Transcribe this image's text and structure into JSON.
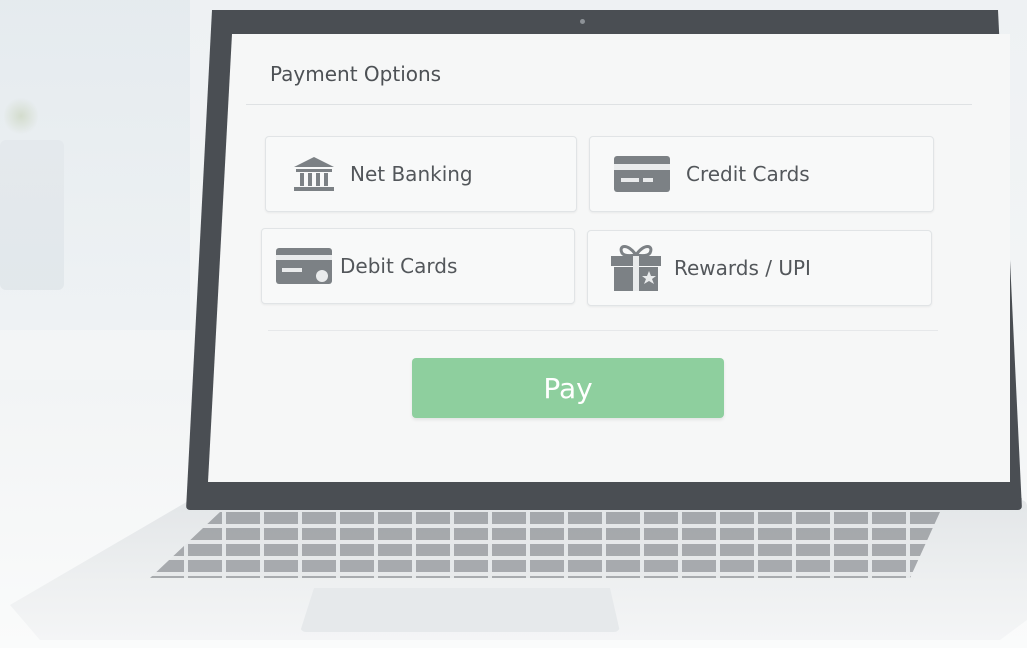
{
  "payment": {
    "title": "Payment Options",
    "options": [
      {
        "label": "Net Banking",
        "icon": "bank-icon"
      },
      {
        "label": "Credit Cards",
        "icon": "credit-card-icon"
      },
      {
        "label": "Debit Cards",
        "icon": "debit-card-icon"
      },
      {
        "label": "Rewards / UPI",
        "icon": "gift-icon"
      }
    ],
    "pay_label": "Pay"
  },
  "colors": {
    "pay_button": "#8ecf9e",
    "icon": "#7c8185",
    "laptop_bezel": "#4a4e53",
    "screen_bg": "#f6f7f7"
  }
}
